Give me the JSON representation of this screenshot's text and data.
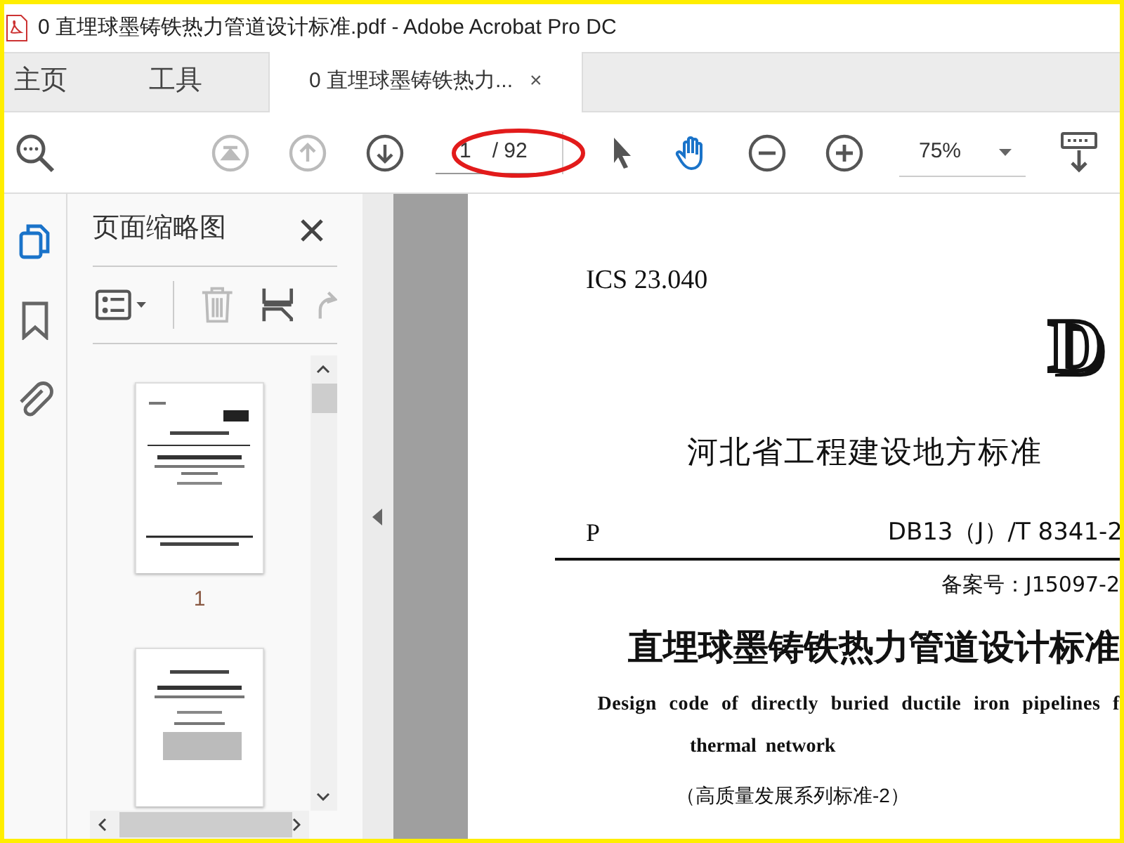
{
  "window": {
    "title": "0 直埋球墨铸铁热力管道设计标准.pdf - Adobe Acrobat Pro DC"
  },
  "tabs": [
    {
      "label": "主页",
      "selected": false,
      "kind": "nav"
    },
    {
      "label": "工具",
      "selected": false,
      "kind": "nav"
    },
    {
      "label": "0 直埋球墨铸铁热力...",
      "selected": true,
      "kind": "document",
      "close": "×"
    }
  ],
  "toolbar": {
    "page_number": "1",
    "page_total": "/ 92",
    "zoom": "75%",
    "tools": [
      {
        "kind": "first-page",
        "disabled": true
      },
      {
        "kind": "previous-page",
        "disabled": true
      },
      {
        "kind": "next-page",
        "disabled": false
      },
      {
        "kind": "select",
        "selected": false
      },
      {
        "kind": "hand",
        "selected": true
      },
      {
        "kind": "zoom-out",
        "selected": false
      },
      {
        "kind": "zoom-in",
        "selected": false
      }
    ]
  },
  "rail": [
    {
      "kind": "pages",
      "selected": true
    },
    {
      "kind": "bookmarks",
      "selected": false
    },
    {
      "kind": "attachments",
      "selected": false
    }
  ],
  "panel": {
    "title": "页面缩略图",
    "thumbnails": [
      {
        "kind": "cover",
        "label": "1"
      },
      {
        "kind": "inner"
      }
    ]
  },
  "document": {
    "ics": "ICS 23.040",
    "logo": "D",
    "authority": "河北省工程建设地方标准",
    "category": "P",
    "code": "DB13（J）/T 8341-2",
    "record": "备案号：J15097-2",
    "title": "直埋球墨铸铁热力管道设计标准",
    "english_title_1": "Design code of directly buried ductile iron pipelines f",
    "english_title_2": "thermal network",
    "series": "（高质量发展系列标准-2）"
  }
}
